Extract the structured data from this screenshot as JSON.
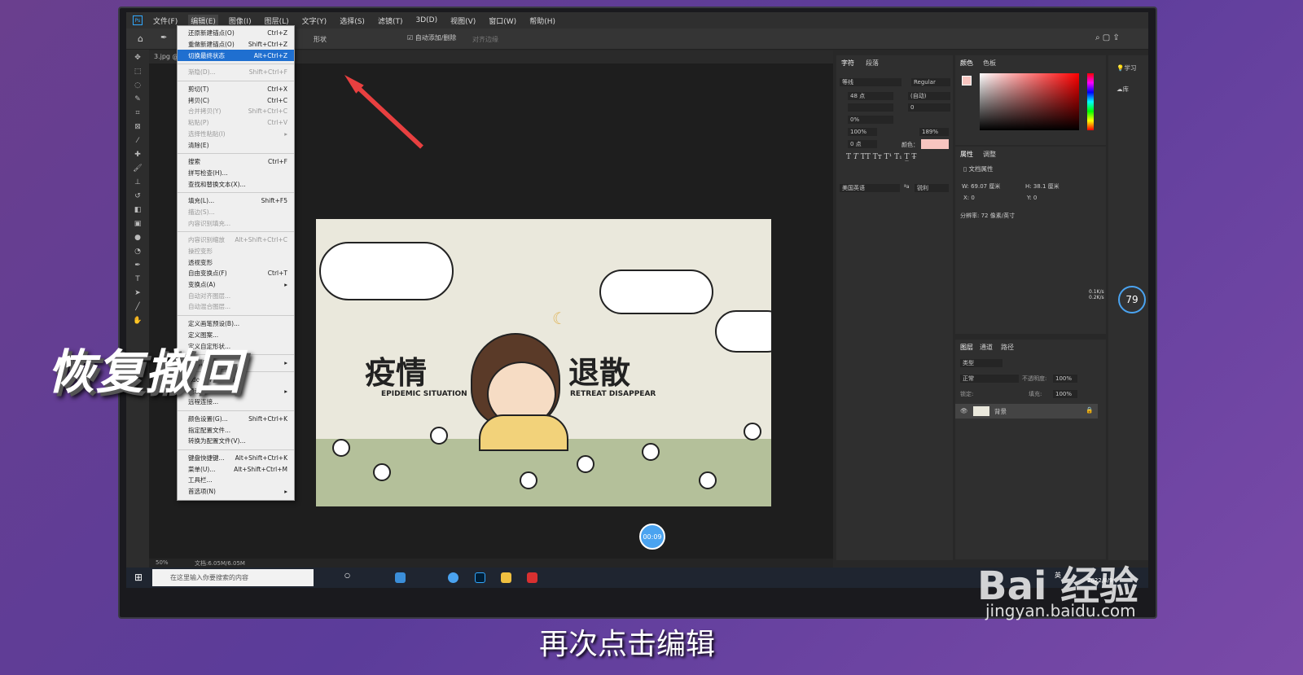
{
  "menubar": {
    "items": [
      "文件(F)",
      "编辑(E)",
      "图像(I)",
      "图层(L)",
      "文字(Y)",
      "选择(S)",
      "滤镜(T)",
      "3D(D)",
      "视图(V)",
      "窗口(W)",
      "帮助(H)"
    ]
  },
  "options": {
    "shape": "形状",
    "auto_add": "自动添加/删除",
    "align_edges": "对齐边缘"
  },
  "document_tab": "3.jpg @",
  "edit_menu": {
    "groups": [
      [
        {
          "label": "还原新建锚点(O)",
          "shortcut": "Ctrl+Z"
        },
        {
          "label": "重做新建锚点(O)",
          "shortcut": "Shift+Ctrl+Z"
        },
        {
          "label": "切换最终状态",
          "shortcut": "Alt+Ctrl+Z",
          "highlight": true
        }
      ],
      [
        {
          "label": "渐隐(D)...",
          "shortcut": "Shift+Ctrl+F",
          "disabled": true
        }
      ],
      [
        {
          "label": "剪切(T)",
          "shortcut": "Ctrl+X"
        },
        {
          "label": "拷贝(C)",
          "shortcut": "Ctrl+C"
        },
        {
          "label": "合并拷贝(Y)",
          "shortcut": "Shift+Ctrl+C",
          "disabled": true
        },
        {
          "label": "粘贴(P)",
          "shortcut": "Ctrl+V",
          "disabled": true
        },
        {
          "label": "选择性粘贴(I)",
          "shortcut": "▸",
          "disabled": true
        },
        {
          "label": "清除(E)",
          "shortcut": ""
        }
      ],
      [
        {
          "label": "搜索",
          "shortcut": "Ctrl+F"
        },
        {
          "label": "拼写检查(H)...",
          "shortcut": ""
        },
        {
          "label": "查找和替换文本(X)...",
          "shortcut": ""
        }
      ],
      [
        {
          "label": "填充(L)...",
          "shortcut": "Shift+F5"
        },
        {
          "label": "描边(S)...",
          "shortcut": "",
          "disabled": true
        },
        {
          "label": "内容识别填充...",
          "shortcut": "",
          "disabled": true
        }
      ],
      [
        {
          "label": "内容识别缩放",
          "shortcut": "Alt+Shift+Ctrl+C",
          "disabled": true
        },
        {
          "label": "操控变形",
          "shortcut": "",
          "disabled": true
        },
        {
          "label": "透视变形",
          "shortcut": ""
        },
        {
          "label": "自由变换点(F)",
          "shortcut": "Ctrl+T"
        },
        {
          "label": "变换点(A)",
          "shortcut": "▸"
        },
        {
          "label": "自动对齐图层...",
          "shortcut": "",
          "disabled": true
        },
        {
          "label": "自动混合图层...",
          "shortcut": "",
          "disabled": true
        }
      ],
      [
        {
          "label": "定义画笔预设(B)...",
          "shortcut": ""
        },
        {
          "label": "定义图案...",
          "shortcut": ""
        },
        {
          "label": "定义自定形状...",
          "shortcut": ""
        }
      ],
      [
        {
          "label": "清理(R)",
          "shortcut": "▸"
        }
      ],
      [
        {
          "label": "Adobe PDF 预设...",
          "shortcut": ""
        },
        {
          "label": "预设",
          "shortcut": "▸"
        },
        {
          "label": "远程连接...",
          "shortcut": ""
        }
      ],
      [
        {
          "label": "颜色设置(G)...",
          "shortcut": "Shift+Ctrl+K"
        },
        {
          "label": "指定配置文件...",
          "shortcut": ""
        },
        {
          "label": "转换为配置文件(V)...",
          "shortcut": ""
        }
      ],
      [
        {
          "label": "键盘快捷键...",
          "shortcut": "Alt+Shift+Ctrl+K"
        },
        {
          "label": "菜单(U)...",
          "shortcut": "Alt+Shift+Ctrl+M"
        },
        {
          "label": "工具栏...",
          "shortcut": ""
        },
        {
          "label": "首选项(N)",
          "shortcut": "▸"
        }
      ]
    ]
  },
  "artwork": {
    "title_left": "疫情",
    "title_right": "退散",
    "sub_left": "EPIDEMIC SITUATION",
    "sub_right": "RETREAT DISAPPEAR"
  },
  "status": {
    "zoom": "50%",
    "doc": "文档:6.05M/6.05M"
  },
  "character_panel": {
    "tabs": [
      "字符",
      "段落"
    ],
    "font": "等线",
    "style": "Regular",
    "size": "48 点",
    "leading": "(自动)",
    "tracking": "0",
    "scale_shift": "0%",
    "vscale": "100%",
    "hscale": "189%",
    "baseline": "0 点",
    "color_label": "颜色：",
    "language": "美国英语",
    "aa_label": "ªa",
    "antialias": "锐利"
  },
  "color_panel": {
    "tabs": [
      "颜色",
      "色板"
    ],
    "fg": "#f7c5c0"
  },
  "properties_panel": {
    "tabs": [
      "属性",
      "调整"
    ],
    "doc_props": "文档属性",
    "w": "W: 69.07 厘米",
    "h": "H: 38.1 厘米",
    "x": "X: 0",
    "y": "Y: 0",
    "resolution": "分辨率: 72 像素/英寸"
  },
  "layers_panel": {
    "tabs": [
      "图层",
      "通道",
      "路径"
    ],
    "filter": "类型",
    "blend": "正常",
    "opacity_label": "不透明度:",
    "opacity": "100%",
    "lock_label": "锁定:",
    "fill_label": "填充:",
    "fill": "100%",
    "layer_name": "背景"
  },
  "learn": {
    "learn": "学习",
    "lib": "库"
  },
  "net": {
    "up": "0.1K/s",
    "down": "0.2K/s",
    "cpu": "79"
  },
  "taskbar": {
    "search_placeholder": "在这里输入你要搜索的内容",
    "ime": "英",
    "time": "2022/8/9"
  },
  "timer": "00:09",
  "captions": {
    "overlay": "恢复撤回",
    "subtitle": "再次点击编辑"
  },
  "watermark": {
    "brand": "Bai 经验",
    "url": "jingyan.baidu.com"
  }
}
